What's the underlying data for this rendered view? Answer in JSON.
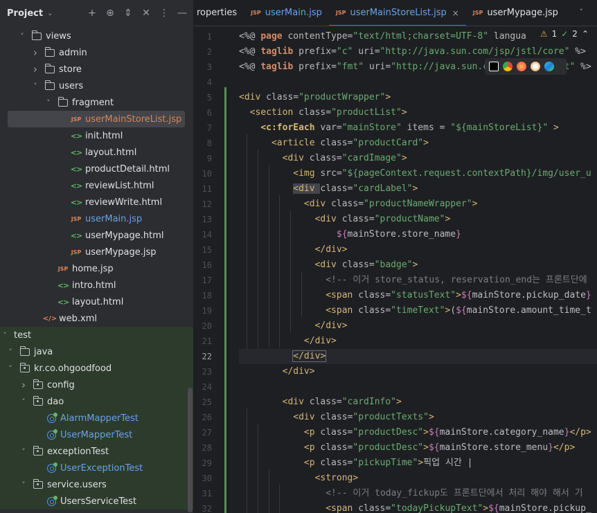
{
  "project": {
    "title": "Project",
    "tree": [
      {
        "label": "views",
        "depth": 1,
        "arrow": "down",
        "icon": "folder"
      },
      {
        "label": "admin",
        "depth": 2,
        "arrow": "right",
        "icon": "folder"
      },
      {
        "label": "store",
        "depth": 2,
        "arrow": "right",
        "icon": "folder"
      },
      {
        "label": "users",
        "depth": 2,
        "arrow": "down",
        "icon": "folder"
      },
      {
        "label": "fragment",
        "depth": 3,
        "arrow": "down",
        "icon": "folder"
      },
      {
        "label": "userMainStoreList.jsp",
        "depth": 4,
        "arrow": "",
        "icon": "jsp",
        "selected": true,
        "color": "modified"
      },
      {
        "label": "init.html",
        "depth": 4,
        "arrow": "",
        "icon": "html"
      },
      {
        "label": "layout.html",
        "depth": 4,
        "arrow": "",
        "icon": "html"
      },
      {
        "label": "productDetail.html",
        "depth": 4,
        "arrow": "",
        "icon": "html"
      },
      {
        "label": "reviewList.html",
        "depth": 4,
        "arrow": "",
        "icon": "html"
      },
      {
        "label": "reviewWrite.html",
        "depth": 4,
        "arrow": "",
        "icon": "html"
      },
      {
        "label": "userMain.jsp",
        "depth": 4,
        "arrow": "",
        "icon": "jsp",
        "color": "modified"
      },
      {
        "label": "userMypage.html",
        "depth": 4,
        "arrow": "",
        "icon": "html"
      },
      {
        "label": "userMypage.jsp",
        "depth": 4,
        "arrow": "",
        "icon": "jsp"
      },
      {
        "label": "home.jsp",
        "depth": 3,
        "arrow": "",
        "icon": "jsp"
      },
      {
        "label": "intro.html",
        "depth": 3,
        "arrow": "",
        "icon": "html"
      },
      {
        "label": "layout.html",
        "depth": 3,
        "arrow": "",
        "icon": "html"
      },
      {
        "label": "web.xml",
        "depth": 2,
        "arrow": "",
        "icon": "xml"
      },
      {
        "label": "test",
        "depth": 0,
        "arrow": "down",
        "icon": "none",
        "test": true
      },
      {
        "label": "java",
        "depth": 1,
        "arrow": "down",
        "icon": "folder",
        "test": true
      },
      {
        "label": "kr.co.ohgoodfood",
        "depth": 1,
        "arrow": "down",
        "icon": "pkg",
        "test": true
      },
      {
        "label": "config",
        "depth": 2,
        "arrow": "right",
        "icon": "pkg",
        "test": true
      },
      {
        "label": "dao",
        "depth": 2,
        "arrow": "down",
        "icon": "pkg",
        "test": true
      },
      {
        "label": "AlarmMapperTest",
        "depth": 3,
        "arrow": "",
        "icon": "class",
        "test": true,
        "color": "modified"
      },
      {
        "label": "UserMapperTest",
        "depth": 3,
        "arrow": "",
        "icon": "class",
        "test": true,
        "color": "modified"
      },
      {
        "label": "exceptionTest",
        "depth": 2,
        "arrow": "down",
        "icon": "pkg",
        "test": true
      },
      {
        "label": "UserExceptionTest",
        "depth": 3,
        "arrow": "",
        "icon": "class",
        "test": true,
        "color": "modified"
      },
      {
        "label": "service.users",
        "depth": 2,
        "arrow": "down",
        "icon": "pkg",
        "test": true
      },
      {
        "label": "UsersServiceTest",
        "depth": 3,
        "arrow": "",
        "icon": "class",
        "test": true
      }
    ]
  },
  "tabs": [
    {
      "label": "roperties",
      "icon": "",
      "active": false
    },
    {
      "label": "userMain.jsp",
      "icon": "JSP",
      "active": false,
      "modified": true
    },
    {
      "label": "userMainStoreList.jsp",
      "icon": "JSP",
      "active": true
    },
    {
      "label": "userMypage.jsp",
      "icon": "JSP",
      "active": false
    }
  ],
  "inspections": {
    "warnings": "1",
    "ok": "2"
  },
  "editor": {
    "current_line": 22,
    "lines": [
      [
        [
          "<%@ ",
          "t-pl"
        ],
        [
          "page ",
          "t-kw"
        ],
        [
          "contentType",
          "t-attr"
        ],
        [
          "=",
          "t-pl"
        ],
        [
          "\"text/html;charset=UTF-8\"",
          "t-str"
        ],
        [
          " langua",
          "t-attr"
        ]
      ],
      [
        [
          "<%@ ",
          "t-pl"
        ],
        [
          "taglib ",
          "t-kw"
        ],
        [
          "prefix",
          "t-attr"
        ],
        [
          "=",
          "t-pl"
        ],
        [
          "\"c\"",
          "t-str"
        ],
        [
          " uri",
          "t-attr"
        ],
        [
          "=",
          "t-pl"
        ],
        [
          "\"http://java.sun.com/jsp/jstl/core\"",
          "t-str"
        ],
        [
          " %>",
          "t-pl"
        ]
      ],
      [
        [
          "<%@ ",
          "t-pl"
        ],
        [
          "taglib ",
          "t-kw"
        ],
        [
          "prefix",
          "t-attr"
        ],
        [
          "=",
          "t-pl"
        ],
        [
          "\"fmt\"",
          "t-str"
        ],
        [
          " uri",
          "t-attr"
        ],
        [
          "=",
          "t-pl"
        ],
        [
          "\"http://java.sun.com/jsp/jstl/fmt\"",
          "t-str"
        ],
        [
          " %>",
          "t-pl"
        ]
      ],
      [],
      [
        [
          "<div ",
          "t-tag"
        ],
        [
          "class",
          "t-attr"
        ],
        [
          "=",
          "t-pl"
        ],
        [
          "\"productWrapper\"",
          "t-str"
        ],
        [
          ">",
          "t-tag"
        ]
      ],
      [
        [
          "  ",
          "t-pl"
        ],
        [
          "<section ",
          "t-tag"
        ],
        [
          "class",
          "t-attr"
        ],
        [
          "=",
          "t-pl"
        ],
        [
          "\"productList\"",
          "t-str"
        ],
        [
          ">",
          "t-tag"
        ]
      ],
      [
        [
          "    ",
          "t-pl"
        ],
        [
          "<c:forEach ",
          "t-ct"
        ],
        [
          "var",
          "t-attr"
        ],
        [
          "=",
          "t-pl"
        ],
        [
          "\"mainStore\"",
          "t-str"
        ],
        [
          " items ",
          "t-attr"
        ],
        [
          "= ",
          "t-pl"
        ],
        [
          "\"${mainStoreList}\"",
          "t-str"
        ],
        [
          " >",
          "t-tag"
        ]
      ],
      [
        [
          "      ",
          "t-pl"
        ],
        [
          "<article ",
          "t-tag"
        ],
        [
          "class",
          "t-attr"
        ],
        [
          "=",
          "t-pl"
        ],
        [
          "\"productCard\"",
          "t-str"
        ],
        [
          ">",
          "t-tag"
        ]
      ],
      [
        [
          "        ",
          "t-pl"
        ],
        [
          "<div ",
          "t-tag"
        ],
        [
          "class",
          "t-attr"
        ],
        [
          "=",
          "t-pl"
        ],
        [
          "\"cardImage\"",
          "t-str"
        ],
        [
          ">",
          "t-tag"
        ]
      ],
      [
        [
          "          ",
          "t-pl"
        ],
        [
          "<img ",
          "t-tag"
        ],
        [
          "src",
          "t-attr"
        ],
        [
          "=",
          "t-pl"
        ],
        [
          "\"${pageContext.request.contextPath}/img/user_u",
          "t-str"
        ]
      ],
      [
        [
          "          ",
          "t-pl"
        ],
        [
          "<div ",
          "t-tag"
        ],
        [
          "class",
          "t-attr"
        ],
        [
          "=",
          "t-pl"
        ],
        [
          "\"cardLabel\"",
          "t-str"
        ],
        [
          ">",
          "t-tag"
        ]
      ],
      [
        [
          "            ",
          "t-pl"
        ],
        [
          "<div ",
          "t-tag"
        ],
        [
          "class",
          "t-attr"
        ],
        [
          "=",
          "t-pl"
        ],
        [
          "\"productNameWrapper\"",
          "t-str"
        ],
        [
          ">",
          "t-tag"
        ]
      ],
      [
        [
          "              ",
          "t-pl"
        ],
        [
          "<div ",
          "t-tag"
        ],
        [
          "class",
          "t-attr"
        ],
        [
          "=",
          "t-pl"
        ],
        [
          "\"productName\"",
          "t-str"
        ],
        [
          ">",
          "t-tag"
        ]
      ],
      [
        [
          "                  ",
          "t-pl"
        ],
        [
          "${",
          "t-el"
        ],
        [
          "mainStore.store_name",
          "t-pl"
        ],
        [
          "}",
          "t-el"
        ]
      ],
      [
        [
          "              ",
          "t-pl"
        ],
        [
          "</div>",
          "t-tag"
        ]
      ],
      [
        [
          "              ",
          "t-pl"
        ],
        [
          "<div ",
          "t-tag"
        ],
        [
          "class",
          "t-attr"
        ],
        [
          "=",
          "t-pl"
        ],
        [
          "\"badge\"",
          "t-str"
        ],
        [
          ">",
          "t-tag"
        ]
      ],
      [
        [
          "                ",
          "t-pl"
        ],
        [
          "<!-- 이거 store_status, reservation_end는 프론트단에",
          "t-cmt"
        ]
      ],
      [
        [
          "                ",
          "t-pl"
        ],
        [
          "<span ",
          "t-tag"
        ],
        [
          "class",
          "t-attr"
        ],
        [
          "=",
          "t-pl"
        ],
        [
          "\"statusText\"",
          "t-str"
        ],
        [
          ">",
          "t-tag"
        ],
        [
          "${",
          "t-el"
        ],
        [
          "mainStore.pickup_date",
          "t-pl"
        ],
        [
          "}",
          "t-el"
        ]
      ],
      [
        [
          "                ",
          "t-pl"
        ],
        [
          "<span ",
          "t-tag"
        ],
        [
          "class",
          "t-attr"
        ],
        [
          "=",
          "t-pl"
        ],
        [
          "\"timeText\"",
          "t-str"
        ],
        [
          ">",
          "t-tag"
        ],
        [
          "(",
          "t-pl"
        ],
        [
          "${",
          "t-el"
        ],
        [
          "mainStore.amount_time_t",
          "t-pl"
        ]
      ],
      [
        [
          "              ",
          "t-pl"
        ],
        [
          "</div>",
          "t-tag"
        ]
      ],
      [
        [
          "            ",
          "t-pl"
        ],
        [
          "</div>",
          "t-tag"
        ]
      ],
      [
        [
          "          ",
          "t-pl"
        ],
        [
          "</div>",
          "t-tag"
        ]
      ],
      [
        [
          "        ",
          "t-pl"
        ],
        [
          "</div>",
          "t-tag"
        ]
      ],
      [],
      [
        [
          "        ",
          "t-pl"
        ],
        [
          "<div ",
          "t-tag"
        ],
        [
          "class",
          "t-attr"
        ],
        [
          "=",
          "t-pl"
        ],
        [
          "\"cardInfo\"",
          "t-str"
        ],
        [
          ">",
          "t-tag"
        ]
      ],
      [
        [
          "          ",
          "t-pl"
        ],
        [
          "<div ",
          "t-tag"
        ],
        [
          "class",
          "t-attr"
        ],
        [
          "=",
          "t-pl"
        ],
        [
          "\"productTexts\"",
          "t-str"
        ],
        [
          ">",
          "t-tag"
        ]
      ],
      [
        [
          "            ",
          "t-pl"
        ],
        [
          "<p ",
          "t-tag"
        ],
        [
          "class",
          "t-attr"
        ],
        [
          "=",
          "t-pl"
        ],
        [
          "\"productDesc\"",
          "t-str"
        ],
        [
          ">",
          "t-tag"
        ],
        [
          "${",
          "t-el"
        ],
        [
          "mainStore.category_name",
          "t-pl"
        ],
        [
          "}",
          "t-el"
        ],
        [
          "</p>",
          "t-tag"
        ]
      ],
      [
        [
          "            ",
          "t-pl"
        ],
        [
          "<p ",
          "t-tag"
        ],
        [
          "class",
          "t-attr"
        ],
        [
          "=",
          "t-pl"
        ],
        [
          "\"productDesc\"",
          "t-str"
        ],
        [
          ">",
          "t-tag"
        ],
        [
          "${",
          "t-el"
        ],
        [
          "mainStore.store_menu",
          "t-pl"
        ],
        [
          "}",
          "t-el"
        ],
        [
          "</p>",
          "t-tag"
        ]
      ],
      [
        [
          "            ",
          "t-pl"
        ],
        [
          "<p ",
          "t-tag"
        ],
        [
          "class",
          "t-attr"
        ],
        [
          "=",
          "t-pl"
        ],
        [
          "\"pickupTime\"",
          "t-str"
        ],
        [
          ">",
          "t-tag"
        ],
        [
          "픽업 시간 |",
          "t-pl"
        ]
      ],
      [
        [
          "              ",
          "t-pl"
        ],
        [
          "<strong>",
          "t-tag"
        ]
      ],
      [
        [
          "                ",
          "t-pl"
        ],
        [
          "<!-- 이거 today_fickup도 프론트단에서 처리 해야 해서 기",
          "t-cmt"
        ]
      ],
      [
        [
          "                ",
          "t-pl"
        ],
        [
          "<span ",
          "t-tag"
        ],
        [
          "class",
          "t-attr"
        ],
        [
          "=",
          "t-pl"
        ],
        [
          "\"todayPickupText\"",
          "t-str"
        ],
        [
          ">",
          "t-tag"
        ],
        [
          "${",
          "t-el"
        ],
        [
          "mainStore.pickup_",
          "t-pl"
        ]
      ]
    ]
  }
}
